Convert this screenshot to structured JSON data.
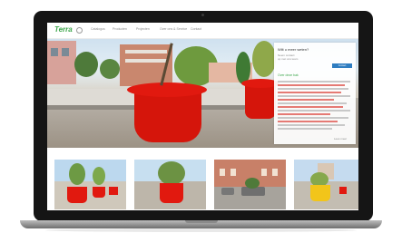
{
  "site": {
    "logo": "Terra",
    "nav_links": [
      "Catalogus",
      "Producten",
      "Projecten",
      "Over ons & Service",
      "Contact"
    ]
  },
  "panel": {
    "title": "Wilt u meer weten?",
    "subtitle_lines": [
      "Neem contact",
      "op met ons team"
    ],
    "button_label": "Contact",
    "section_heading": "Over deze bak",
    "more_label": "Lees meer"
  },
  "colors": {
    "brand": "#3da64b",
    "planter_red": "#e1190f",
    "planter_yellow": "#f2c51a",
    "button_blue": "#2f7dc1"
  },
  "thumbnails": [
    {
      "name": "red planters with trees"
    },
    {
      "name": "red planter with palm"
    },
    {
      "name": "grey planters by building"
    },
    {
      "name": "yellow planter"
    }
  ]
}
